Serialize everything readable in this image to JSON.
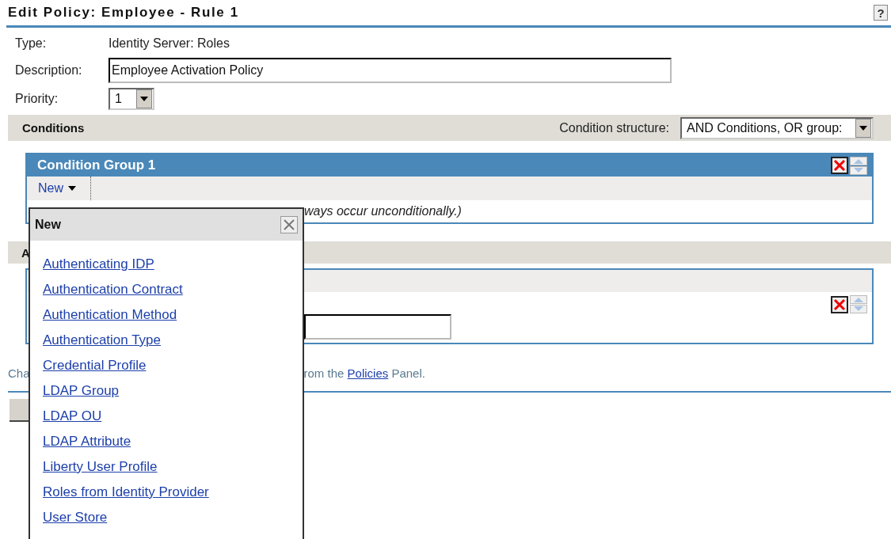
{
  "title": "Edit Policy: Employee - Rule 1",
  "help_button": "?",
  "fields": [
    {
      "label": "Type:",
      "kind": "text",
      "value": "Identity Server: Roles"
    },
    {
      "label": "Description:",
      "kind": "input",
      "value": "Employee Activation Policy"
    },
    {
      "label": "Priority:",
      "kind": "select",
      "value": "1"
    }
  ],
  "conditions": {
    "heading": "Conditions",
    "structure_label": "Condition structure:",
    "structure_value": "AND Conditions, OR group:",
    "group": {
      "title": "Condition Group 1",
      "new_button": "New",
      "note_fragment": "ways occur unconditionally.)"
    }
  },
  "actions": {
    "heading_fragment": "A"
  },
  "footer": {
    "text_fragment": "Cha",
    "text_before_link": "rom the ",
    "link": "Policies",
    "text_after_link": " Panel."
  },
  "new_menu": {
    "title": "New",
    "items": [
      "Authenticating IDP",
      "Authentication Contract",
      "Authentication Method",
      "Authentication Type",
      "Credential Profile",
      "LDAP Group",
      "LDAP OU",
      "LDAP Attribute",
      "Liberty User Profile",
      "Roles from Identity Provider",
      "User Store"
    ]
  }
}
